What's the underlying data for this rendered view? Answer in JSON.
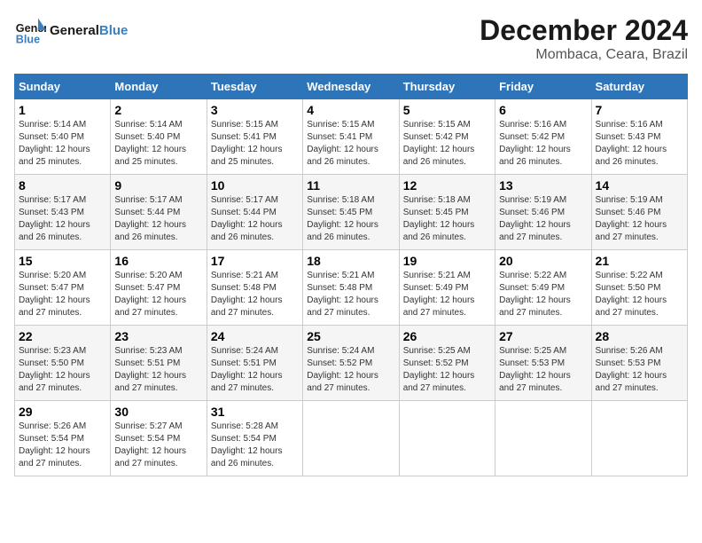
{
  "header": {
    "logo_line1": "General",
    "logo_line2": "Blue",
    "title": "December 2024",
    "subtitle": "Mombaca, Ceara, Brazil"
  },
  "weekdays": [
    "Sunday",
    "Monday",
    "Tuesday",
    "Wednesday",
    "Thursday",
    "Friday",
    "Saturday"
  ],
  "weeks": [
    [
      {
        "day": "1",
        "sunrise": "5:14 AM",
        "sunset": "5:40 PM",
        "daylight": "12 hours and 25 minutes."
      },
      {
        "day": "2",
        "sunrise": "5:14 AM",
        "sunset": "5:40 PM",
        "daylight": "12 hours and 25 minutes."
      },
      {
        "day": "3",
        "sunrise": "5:15 AM",
        "sunset": "5:41 PM",
        "daylight": "12 hours and 25 minutes."
      },
      {
        "day": "4",
        "sunrise": "5:15 AM",
        "sunset": "5:41 PM",
        "daylight": "12 hours and 26 minutes."
      },
      {
        "day": "5",
        "sunrise": "5:15 AM",
        "sunset": "5:42 PM",
        "daylight": "12 hours and 26 minutes."
      },
      {
        "day": "6",
        "sunrise": "5:16 AM",
        "sunset": "5:42 PM",
        "daylight": "12 hours and 26 minutes."
      },
      {
        "day": "7",
        "sunrise": "5:16 AM",
        "sunset": "5:43 PM",
        "daylight": "12 hours and 26 minutes."
      }
    ],
    [
      {
        "day": "8",
        "sunrise": "5:17 AM",
        "sunset": "5:43 PM",
        "daylight": "12 hours and 26 minutes."
      },
      {
        "day": "9",
        "sunrise": "5:17 AM",
        "sunset": "5:44 PM",
        "daylight": "12 hours and 26 minutes."
      },
      {
        "day": "10",
        "sunrise": "5:17 AM",
        "sunset": "5:44 PM",
        "daylight": "12 hours and 26 minutes."
      },
      {
        "day": "11",
        "sunrise": "5:18 AM",
        "sunset": "5:45 PM",
        "daylight": "12 hours and 26 minutes."
      },
      {
        "day": "12",
        "sunrise": "5:18 AM",
        "sunset": "5:45 PM",
        "daylight": "12 hours and 26 minutes."
      },
      {
        "day": "13",
        "sunrise": "5:19 AM",
        "sunset": "5:46 PM",
        "daylight": "12 hours and 27 minutes."
      },
      {
        "day": "14",
        "sunrise": "5:19 AM",
        "sunset": "5:46 PM",
        "daylight": "12 hours and 27 minutes."
      }
    ],
    [
      {
        "day": "15",
        "sunrise": "5:20 AM",
        "sunset": "5:47 PM",
        "daylight": "12 hours and 27 minutes."
      },
      {
        "day": "16",
        "sunrise": "5:20 AM",
        "sunset": "5:47 PM",
        "daylight": "12 hours and 27 minutes."
      },
      {
        "day": "17",
        "sunrise": "5:21 AM",
        "sunset": "5:48 PM",
        "daylight": "12 hours and 27 minutes."
      },
      {
        "day": "18",
        "sunrise": "5:21 AM",
        "sunset": "5:48 PM",
        "daylight": "12 hours and 27 minutes."
      },
      {
        "day": "19",
        "sunrise": "5:21 AM",
        "sunset": "5:49 PM",
        "daylight": "12 hours and 27 minutes."
      },
      {
        "day": "20",
        "sunrise": "5:22 AM",
        "sunset": "5:49 PM",
        "daylight": "12 hours and 27 minutes."
      },
      {
        "day": "21",
        "sunrise": "5:22 AM",
        "sunset": "5:50 PM",
        "daylight": "12 hours and 27 minutes."
      }
    ],
    [
      {
        "day": "22",
        "sunrise": "5:23 AM",
        "sunset": "5:50 PM",
        "daylight": "12 hours and 27 minutes."
      },
      {
        "day": "23",
        "sunrise": "5:23 AM",
        "sunset": "5:51 PM",
        "daylight": "12 hours and 27 minutes."
      },
      {
        "day": "24",
        "sunrise": "5:24 AM",
        "sunset": "5:51 PM",
        "daylight": "12 hours and 27 minutes."
      },
      {
        "day": "25",
        "sunrise": "5:24 AM",
        "sunset": "5:52 PM",
        "daylight": "12 hours and 27 minutes."
      },
      {
        "day": "26",
        "sunrise": "5:25 AM",
        "sunset": "5:52 PM",
        "daylight": "12 hours and 27 minutes."
      },
      {
        "day": "27",
        "sunrise": "5:25 AM",
        "sunset": "5:53 PM",
        "daylight": "12 hours and 27 minutes."
      },
      {
        "day": "28",
        "sunrise": "5:26 AM",
        "sunset": "5:53 PM",
        "daylight": "12 hours and 27 minutes."
      }
    ],
    [
      {
        "day": "29",
        "sunrise": "5:26 AM",
        "sunset": "5:54 PM",
        "daylight": "12 hours and 27 minutes."
      },
      {
        "day": "30",
        "sunrise": "5:27 AM",
        "sunset": "5:54 PM",
        "daylight": "12 hours and 27 minutes."
      },
      {
        "day": "31",
        "sunrise": "5:28 AM",
        "sunset": "5:54 PM",
        "daylight": "12 hours and 26 minutes."
      },
      null,
      null,
      null,
      null
    ]
  ],
  "labels": {
    "sunrise": "Sunrise:",
    "sunset": "Sunset:",
    "daylight": "Daylight:"
  }
}
